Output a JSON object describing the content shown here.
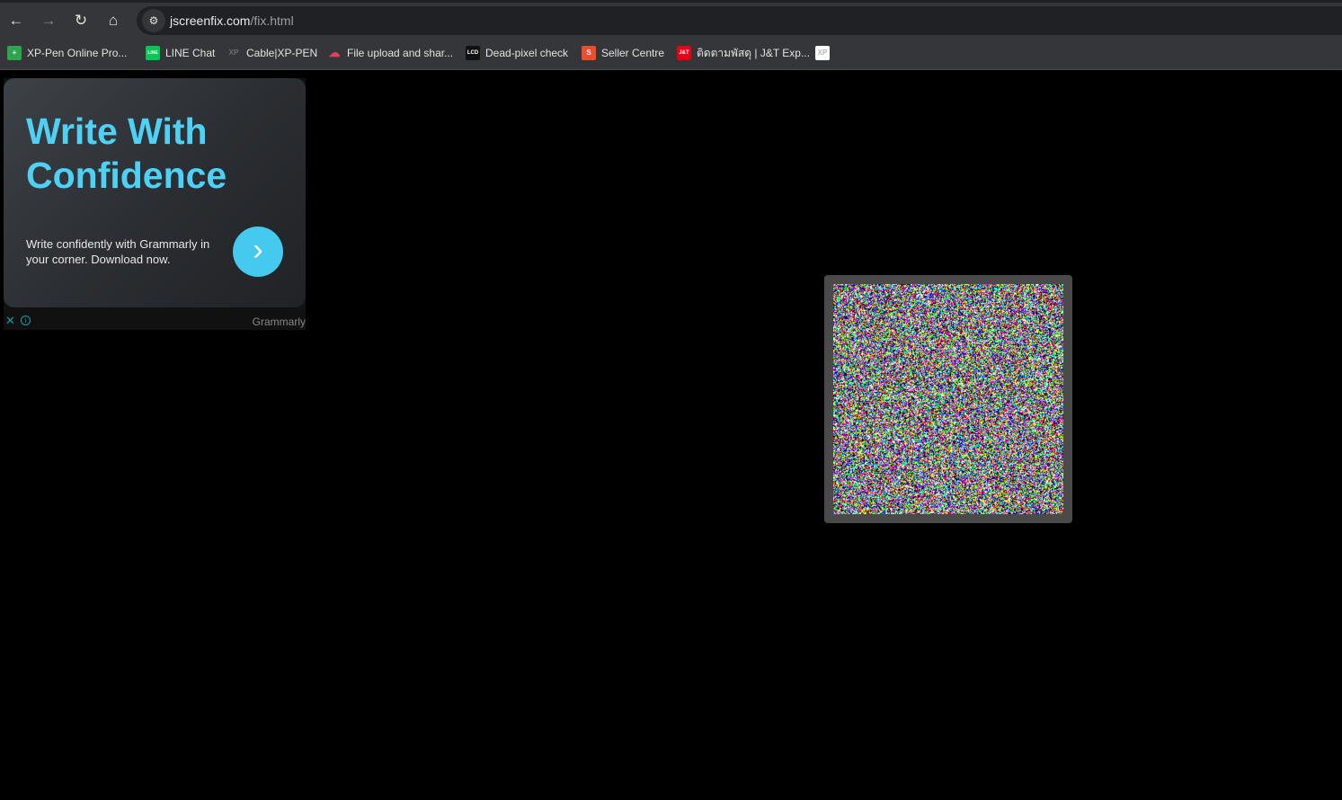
{
  "toolbar": {
    "back_icon": "arrow-left",
    "forward_icon": "arrow-right",
    "reload_icon": "reload",
    "home_icon": "home",
    "url_domain": "jscreenfix.com",
    "url_path": "/fix.html"
  },
  "bookmarks": [
    {
      "label": "XP-Pen Online Pro...",
      "icon_color": "#2ea44f",
      "icon_text": "+"
    },
    {
      "label": "LINE Chat",
      "icon_color": "#06c755",
      "icon_text": "LINE"
    },
    {
      "label": "Cable|XP-PEN",
      "icon_color": "#35363a",
      "icon_text": "XP"
    },
    {
      "label": "File upload and shar...",
      "icon_color": "#35363a",
      "icon_text": "☁"
    },
    {
      "label": "Dead-pixel check",
      "icon_color": "#111111",
      "icon_text": "LCD"
    },
    {
      "label": "Seller Centre",
      "icon_color": "#ee4d2d",
      "icon_text": "S"
    },
    {
      "label": "ติดตามพัสดุ | J&T Exp...",
      "icon_color": "#e60012",
      "icon_text": "J&T"
    },
    {
      "label": "",
      "icon_color": "#ffffff",
      "icon_text": "XP"
    }
  ],
  "ad": {
    "headline_line1": "Write With",
    "headline_line2": "Confidence",
    "body": "Write confidently with Grammarly in your corner. Download now.",
    "cta_icon": "chevron-right",
    "close_label": "✕",
    "info_label": "i",
    "brand": "Grammarly",
    "accent": "#4fd1f5"
  },
  "fixer": {
    "type": "random-color-noise"
  }
}
